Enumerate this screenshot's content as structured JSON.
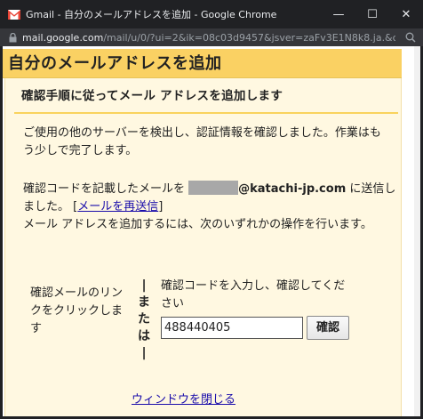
{
  "window": {
    "title": "Gmail - 自分のメールアドレスを追加 - Google Chrome",
    "url_host": "mail.google.com",
    "url_path": "/mail/u/0/?ui=2&ik=08c03d9457&jsver=zaFv3E1N8k8.ja.&cbl=gmail_...",
    "controls": {
      "minimize": "—",
      "maximize": "☐",
      "close": "✕"
    }
  },
  "header": {
    "title": "自分のメールアドレスを追加"
  },
  "subheader": {
    "title": "確認手順に従ってメール アドレスを追加します"
  },
  "body": {
    "p1": "ご使用の他のサーバーを検出し、認証情報を確認しました。作業はもう少しで完了します。",
    "p2_prefix": "確認コードを記載したメールを ",
    "p2_domain": "@katachi-jp.com",
    "p2_mid": " に送信しました。 [",
    "resend_link": "メールを再送信",
    "p2_suffix": "]",
    "p3": "メール アドレスを追加するには、次のいずれかの操作を行います。"
  },
  "options": {
    "left_label": "確認メールのリンクをクリックします",
    "or_text": "|\nま\nた\nは\n|",
    "right_label": "確認コードを入力し、確認してください",
    "code_value": "488440405",
    "confirm_button": "確認"
  },
  "close_link": "ウィンドウを閉じる",
  "colors": {
    "header_bg": "#fad163",
    "panel_bg": "#fff8e1",
    "link": "#1a0dab"
  }
}
